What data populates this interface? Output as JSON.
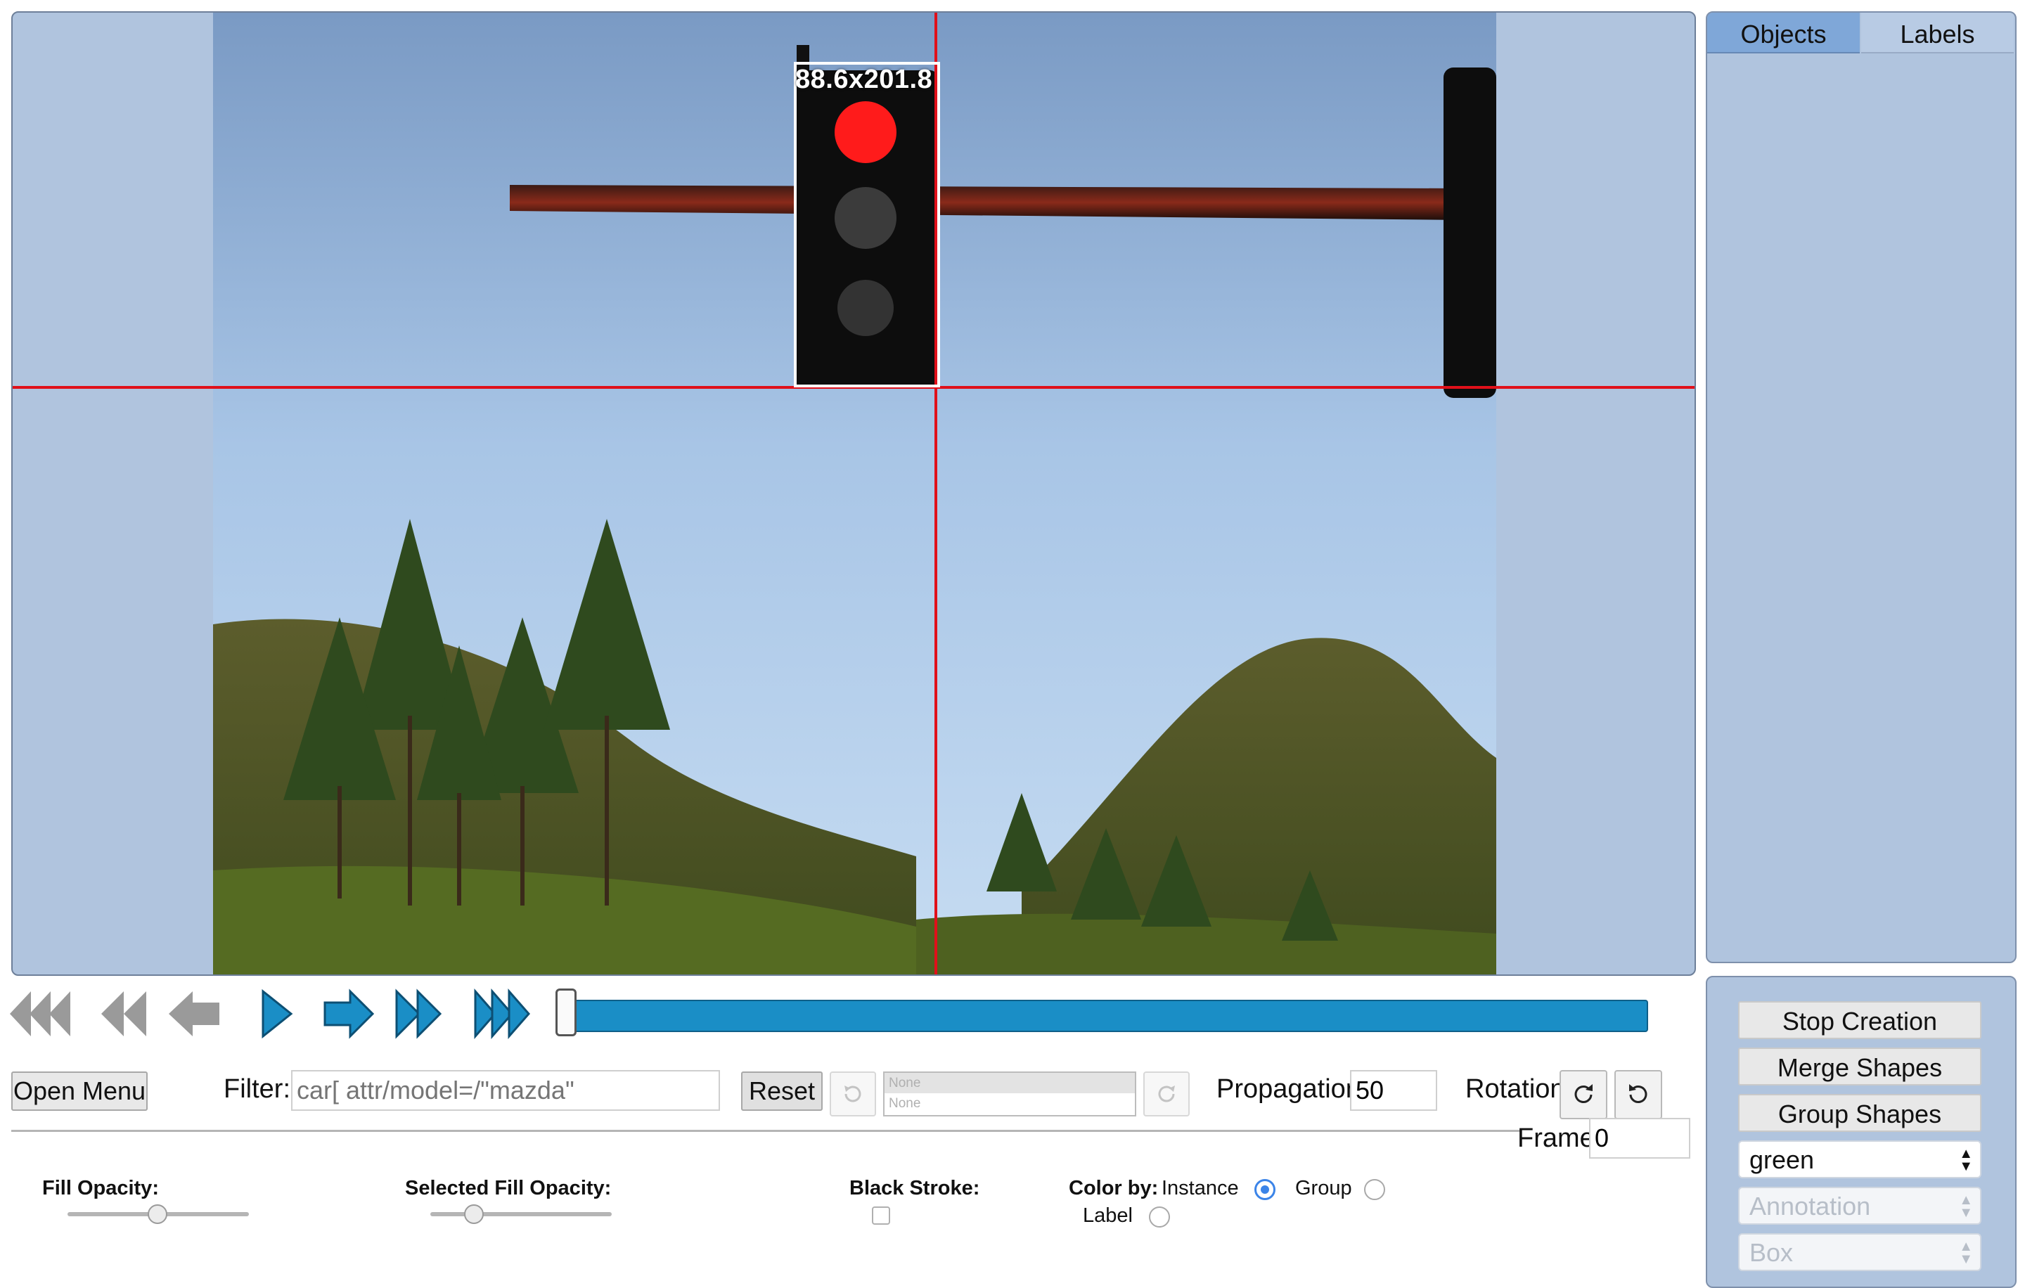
{
  "canvas": {
    "bbox_label": "88.6x201.8"
  },
  "sidebar": {
    "tabs": [
      {
        "label": "Objects",
        "active": true
      },
      {
        "label": "Labels",
        "active": false
      }
    ]
  },
  "panel": {
    "stop_creation": "Stop Creation",
    "merge_shapes": "Merge Shapes",
    "group_shapes": "Group Shapes",
    "color_select": "green",
    "annotation_select": "Annotation",
    "shape_select": "Box"
  },
  "playback": {
    "icons": [
      "fast-backward-icon",
      "backward-icon",
      "prev-frame-icon",
      "play-icon",
      "next-frame-icon",
      "forward-icon",
      "fast-forward-icon"
    ],
    "progress": 0.0,
    "accent_color": "#1a8ec6"
  },
  "toolbar": {
    "open_menu": "Open Menu",
    "filter_label": "Filter:",
    "filter_placeholder": "car[ attr/model=/\"mazda\"",
    "reset": "Reset",
    "history_top": "None",
    "history_bottom": "None",
    "propagation_label": "Propagation",
    "propagation_value": "50",
    "rotation_label": "Rotation",
    "frame_label": "Frame",
    "frame_value": "0"
  },
  "settings": {
    "fill_opacity_label": "Fill Opacity:",
    "fill_opacity_value": 0.5,
    "selected_fill_opacity_label": "Selected Fill Opacity:",
    "selected_fill_opacity_value": 0.2,
    "black_stroke_label": "Black Stroke:",
    "black_stroke_checked": false,
    "color_by_label": "Color by:",
    "color_by_options": [
      "Instance",
      "Group",
      "Label"
    ],
    "color_by_selected": "Instance"
  }
}
